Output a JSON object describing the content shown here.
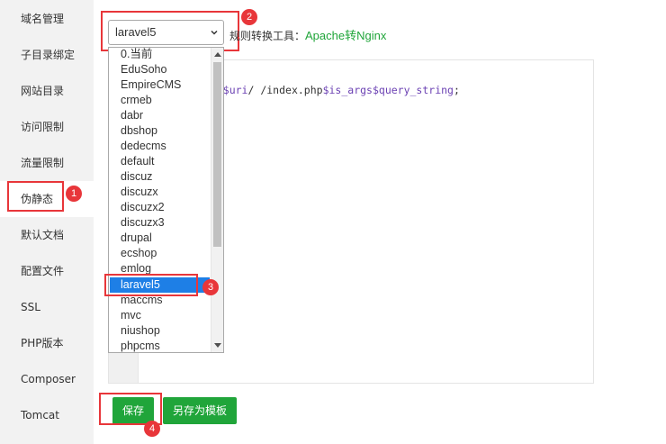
{
  "sidebar": {
    "items": [
      {
        "label": "域名管理"
      },
      {
        "label": "子目录绑定"
      },
      {
        "label": "网站目录"
      },
      {
        "label": "访问限制"
      },
      {
        "label": "流量限制"
      },
      {
        "label": "伪静态"
      },
      {
        "label": "默认文档"
      },
      {
        "label": "配置文件"
      },
      {
        "label": "SSL"
      },
      {
        "label": "PHP版本"
      },
      {
        "label": "Composer"
      },
      {
        "label": "Tomcat"
      }
    ],
    "active": "伪静态"
  },
  "rewrite": {
    "selected_value": "laravel5",
    "tool_prefix": "规则转换工具：",
    "tool_link": "Apache转Nginx",
    "options": [
      "0.当前",
      "EduSoho",
      "EmpireCMS",
      "crmeb",
      "dabr",
      "dbshop",
      "dedecms",
      "default",
      "discuz",
      "discuzx",
      "discuzx2",
      "discuzx3",
      "drupal",
      "ecshop",
      "emlog",
      "laravel5",
      "maccms",
      "mvc",
      "niushop",
      "phpcms"
    ]
  },
  "editor": {
    "code_fragment_prefix": "ri ",
    "code_var_uri": "$uri",
    "code_middle": "/ /index.php",
    "code_var_args": "$is_args",
    "code_var_qs": "$query_string",
    "code_suffix": ";"
  },
  "buttons": {
    "save": "保存",
    "save_as_template": "另存为模板"
  },
  "annotations": [
    "1",
    "2",
    "3",
    "4"
  ],
  "colors": {
    "accent_green": "#20a53a",
    "highlight_red": "#e8363a",
    "selection_blue": "#1e7fe6",
    "code_variable": "#6b41b3"
  }
}
